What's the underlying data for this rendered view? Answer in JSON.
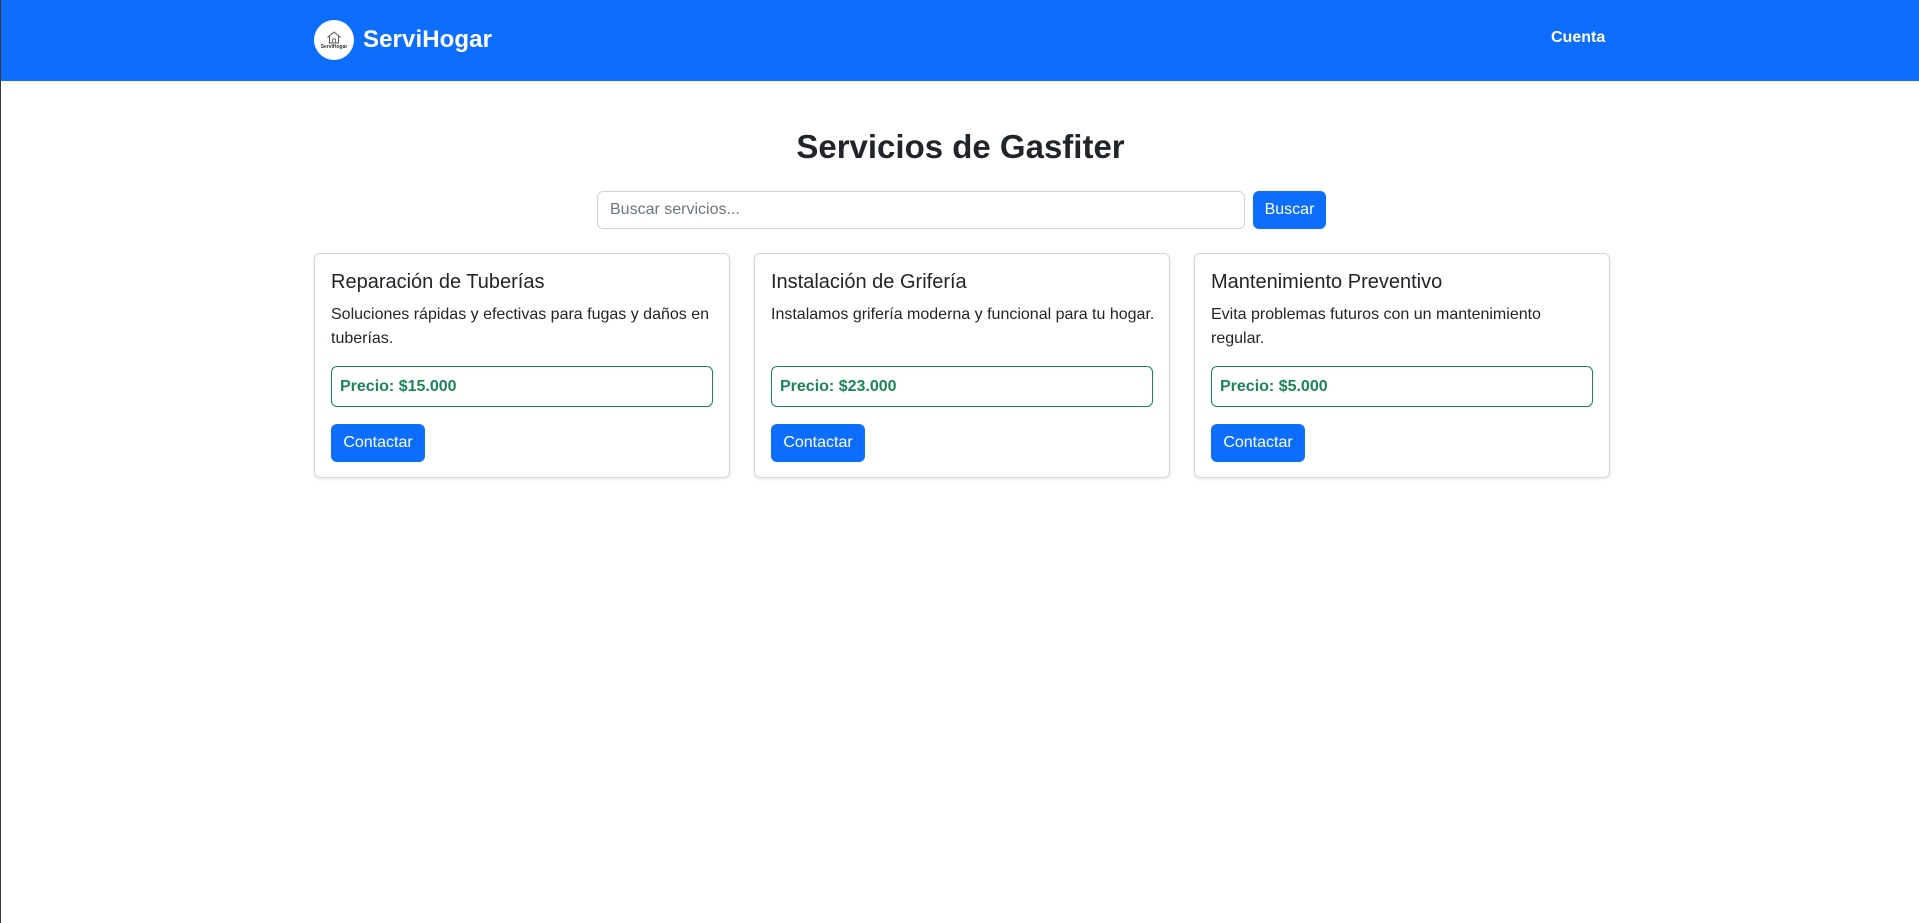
{
  "navbar": {
    "brand_name": "ServiHogar",
    "logo_text": "ServiHogar",
    "account_link": "Cuenta"
  },
  "main": {
    "title": "Servicios de Gasfiter",
    "search": {
      "placeholder": "Buscar servicios...",
      "value": "",
      "button_label": "Buscar"
    },
    "cards": [
      {
        "title": "Reparación de Tuberías",
        "description": "Soluciones rápidas y efectivas para fugas y daños en tuberías.",
        "price": "Precio: $15.000",
        "button_label": "Contactar"
      },
      {
        "title": "Instalación de Grifería",
        "description": "Instalamos grifería moderna y funcional para tu hogar.",
        "price": "Precio: $23.000",
        "button_label": "Contactar"
      },
      {
        "title": "Mantenimiento Preventivo",
        "description": "Evita problemas futuros con un mantenimiento regular.",
        "price": "Precio: $5.000",
        "button_label": "Contactar"
      }
    ]
  },
  "colors": {
    "primary": "#0d6efd",
    "success": "#198754",
    "text": "#212529"
  },
  "icons": {
    "logo": "house-icon"
  }
}
